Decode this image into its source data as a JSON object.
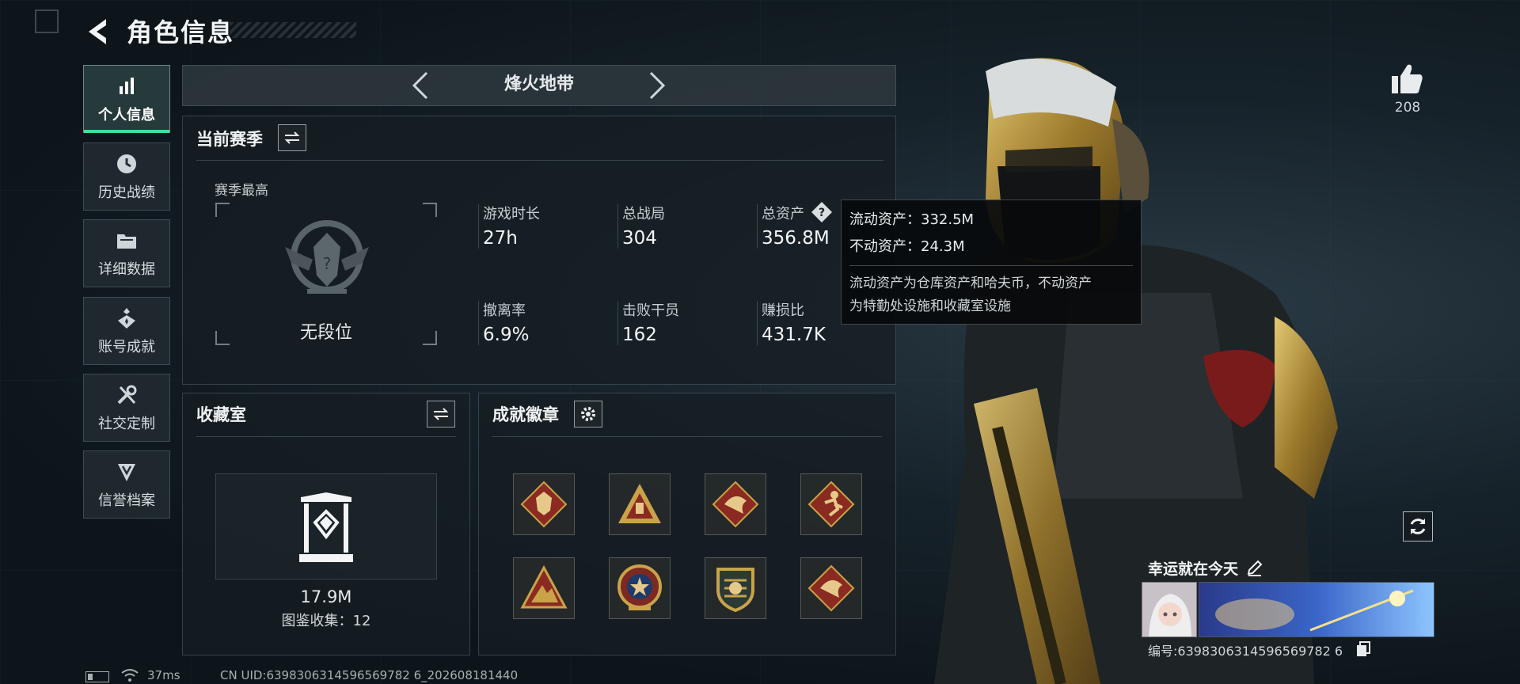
{
  "header": {
    "title": "角色信息"
  },
  "nav": {
    "items": [
      {
        "label": "个人信息",
        "icon": "bar-chart-icon",
        "active": true
      },
      {
        "label": "历史战绩",
        "icon": "clock-icon",
        "active": false
      },
      {
        "label": "详细数据",
        "icon": "folder-icon",
        "active": false
      },
      {
        "label": "账号成就",
        "icon": "achievement-icon",
        "active": false
      },
      {
        "label": "社交定制",
        "icon": "tools-icon",
        "active": false
      },
      {
        "label": "信誉档案",
        "icon": "shield-icon",
        "active": false
      }
    ]
  },
  "mode": {
    "title": "烽火地带"
  },
  "season": {
    "title": "当前赛季",
    "best_label": "赛季最高",
    "rank": "无段位",
    "stats": [
      {
        "label": "游戏时长",
        "value": "27h"
      },
      {
        "label": "总战局",
        "value": "304"
      },
      {
        "label": "总资产",
        "value": "356.8M"
      },
      {
        "label": "撤离率",
        "value": "6.9%"
      },
      {
        "label": "击败干员",
        "value": "162"
      },
      {
        "label": "赚损比",
        "value": "431.7K"
      }
    ]
  },
  "tooltip": {
    "liquid": "流动资产：332.5M",
    "fixed": "不动资产：24.3M",
    "desc_line1": "流动资产为仓库资产和哈夫币，不动资产",
    "desc_line2": "为特勤处设施和收藏室设施"
  },
  "collection": {
    "title": "收藏室",
    "value": "17.9M",
    "count": "图鉴收集：12"
  },
  "badges": {
    "title": "成就徽章",
    "items": [
      {
        "icon": "wolf-badge-icon"
      },
      {
        "icon": "triangle-badge-icon"
      },
      {
        "icon": "dragon-badge-icon"
      },
      {
        "icon": "runner-badge-icon"
      },
      {
        "icon": "mountain-badge-icon"
      },
      {
        "icon": "star-shield-badge-icon"
      },
      {
        "icon": "crest-badge-icon"
      },
      {
        "icon": "dragon-badge-icon"
      }
    ]
  },
  "profile": {
    "likes": "208",
    "signature": "幸运就在今天",
    "player_id": "编号:639830631459656978 26",
    "player_id_full": "编号:6398306314596569782 6"
  },
  "status": {
    "ping": "37ms",
    "uid": "CN UID:6398306314596569782 6_202608181440"
  },
  "colors": {
    "accent": "#3de0a0",
    "badge_red": "#8a2a20",
    "badge_gold": "#c9a24a"
  }
}
